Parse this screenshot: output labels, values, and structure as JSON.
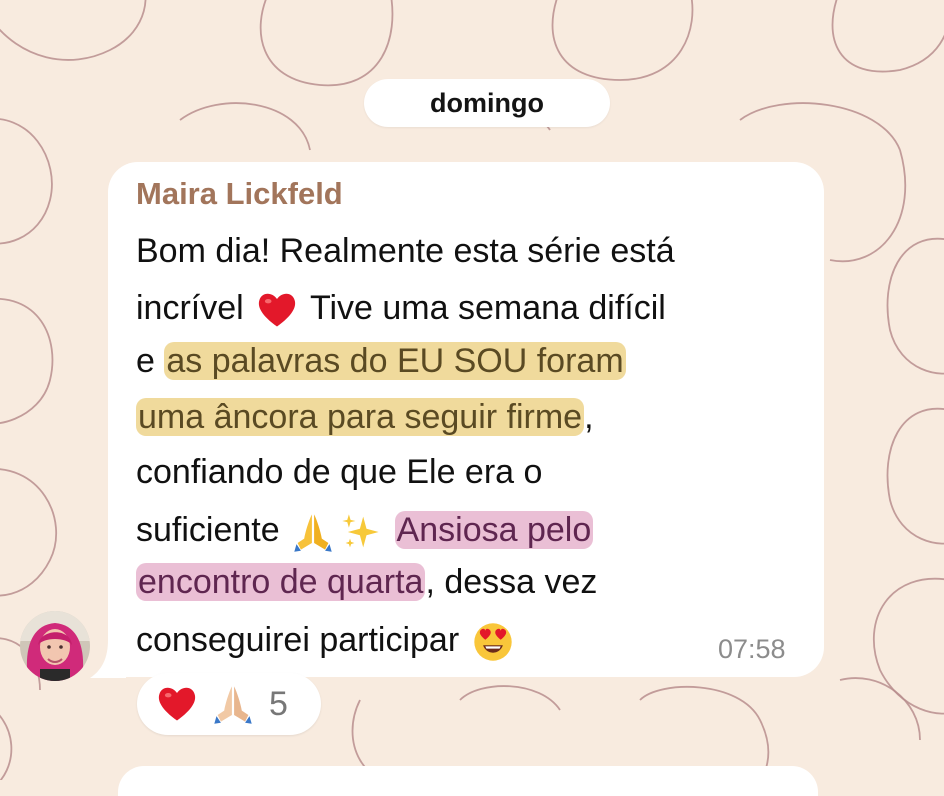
{
  "chat": {
    "date_separator": "domingo",
    "message": {
      "sender": "Maira Lickfeld",
      "lines": [
        [
          {
            "t": "Bom dia! Realmente esta série está"
          }
        ],
        [
          {
            "t": "incrível "
          },
          {
            "e": "heart"
          },
          {
            "t": " Tive uma semana difícil"
          }
        ],
        [
          {
            "t": "e "
          },
          {
            "t": "as palavras do EU SOU foram",
            "h": "yellow"
          }
        ],
        [
          {
            "t": "uma âncora para seguir firme",
            "h": "yellow"
          },
          {
            "t": ","
          }
        ],
        [
          {
            "t": "confiando de que Ele era o"
          }
        ],
        [
          {
            "t": "suficiente "
          },
          {
            "e": "praying-hands"
          },
          {
            "e": "sparkles"
          },
          {
            "t": " "
          },
          {
            "t": "Ansiosa pelo",
            "h": "pink"
          }
        ],
        [
          {
            "t": "encontro de quarta",
            "h": "pink"
          },
          {
            "t": ", dessa vez"
          }
        ],
        [
          {
            "t": "conseguirei participar "
          },
          {
            "e": "heart-eyes"
          }
        ]
      ],
      "time": "07:58"
    },
    "reactions": {
      "emojis": [
        "heart-icon",
        "praying-hands-icon"
      ],
      "count": "5"
    }
  },
  "colors": {
    "wallpaper": "#f8ebdf",
    "wallpaper_pattern": "#b98e8e",
    "sender": "#a2755b",
    "highlight_yellow": "#e6c460",
    "highlight_pink": "#d88ab2",
    "timestamp": "#8c8c8c"
  }
}
